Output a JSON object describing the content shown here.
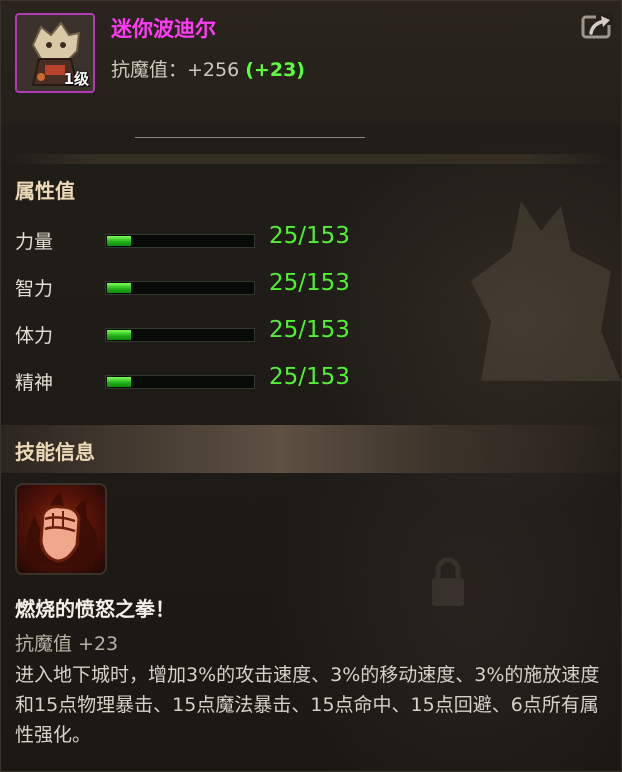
{
  "pet": {
    "name": "迷你波迪尔",
    "level": "1级",
    "stat_label": "抗魔值：",
    "stat_value": "+256",
    "stat_bonus": "(+23)"
  },
  "attributes_section": {
    "title": "属性值",
    "items": [
      {
        "label": "力量",
        "value": "25/153",
        "fill": 0.163
      },
      {
        "label": "智力",
        "value": "25/153",
        "fill": 0.163
      },
      {
        "label": "体力",
        "value": "25/153",
        "fill": 0.163
      },
      {
        "label": "精神",
        "value": "25/153",
        "fill": 0.163
      }
    ]
  },
  "skill_section": {
    "title": "技能信息",
    "skill_name": "燃烧的愤怒之拳！",
    "skill_stat": "抗魔值 +23",
    "skill_desc": "进入地下城时，增加3%的攻击速度、3%的移动速度、3%的施放速度和15点物理暴击、15点魔法暴击、15点命中、15点回避、6点所有属性强化。",
    "icon": "flaming-fist-icon"
  },
  "icons": {
    "export": "export-icon",
    "pet_portrait": "pet-portrait-icon"
  },
  "colors": {
    "pet_name": "#ff3bf5",
    "bonus": "#5cff3b",
    "bar_fill": "#1eae16",
    "value_text": "#52f033",
    "portrait_border": "#b23ab5"
  }
}
